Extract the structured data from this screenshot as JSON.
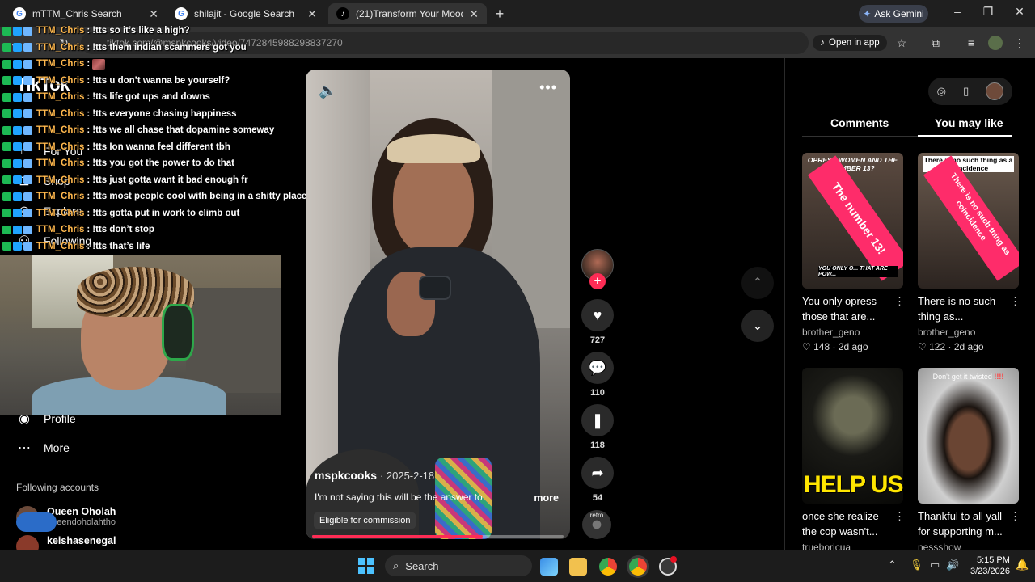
{
  "browser": {
    "tabs": [
      {
        "title": "mTTM_Chris Search",
        "favicon": "G"
      },
      {
        "title": "shilajit - Google Search",
        "favicon": "G"
      },
      {
        "title": "(21)Transform Your Mood with",
        "favicon": "♪"
      }
    ],
    "new_tab": "+",
    "gemini_label": "Ask Gemini",
    "url": "tiktok.com/@mspkcooks/video/7472845988298837270",
    "open_in_app": "Open in app",
    "window_controls": [
      "–",
      "❐",
      "✕"
    ]
  },
  "sidebar": {
    "logo": "TikTok",
    "nav": [
      {
        "label": "For You",
        "icon": "home-icon"
      },
      {
        "label": "Shop",
        "icon": "bag-icon"
      },
      {
        "label": "Explore",
        "icon": "compass-icon"
      },
      {
        "label": "Following",
        "icon": "users-icon"
      },
      {
        "label": "Profile",
        "icon": "profile-icon"
      },
      {
        "label": "More",
        "icon": "dots-icon"
      }
    ],
    "following_title": "Following accounts",
    "accounts": [
      {
        "name": "Queen Oholah",
        "handle": "queendoholahtho"
      },
      {
        "name": "keishasenegal",
        "handle": ""
      }
    ]
  },
  "chat": [
    {
      "user": "TTM_Chris",
      "msg": "!tts so it’s like a high?"
    },
    {
      "user": "TTM_Chris",
      "msg": "!tts them indian scammers got you"
    },
    {
      "user": "TTM_Chris",
      "msg": ""
    },
    {
      "user": "TTM_Chris",
      "msg": "!tts u don’t wanna be yourself?"
    },
    {
      "user": "TTM_Chris",
      "msg": "!tts life got ups and downs"
    },
    {
      "user": "TTM_Chris",
      "msg": "!tts everyone chasing happiness"
    },
    {
      "user": "TTM_Chris",
      "msg": "!tts we all chase that dopamine someway"
    },
    {
      "user": "TTM_Chris",
      "msg": "!tts Ion wanna feel different tbh"
    },
    {
      "user": "TTM_Chris",
      "msg": "!tts you got the power to do that"
    },
    {
      "user": "TTM_Chris",
      "msg": "!tts just gotta want it bad enough fr"
    },
    {
      "user": "TTM_Chris",
      "msg": "!tts most people cool with being in a shitty place"
    },
    {
      "user": "TTM_Chris",
      "msg": "!tts gotta put in work to climb out"
    },
    {
      "user": "TTM_Chris",
      "msg": "!tts don’t stop"
    },
    {
      "user": "TTM_Chris",
      "msg": "!tts that’s life"
    }
  ],
  "video": {
    "author": "mspkcooks",
    "date": "· 2025-2-18",
    "caption": "I'm not saying this will be the answer to",
    "more": "more",
    "badge": "Eligible for commission",
    "progress": 0.68
  },
  "actions": {
    "likes": "727",
    "comments": "110",
    "saves": "118",
    "shares": "54",
    "disc_label": "retro"
  },
  "right_panel": {
    "tabs": [
      "Comments",
      "You may like"
    ],
    "active_tab": "You may like",
    "cards": [
      {
        "title": "You only opress those that are...",
        "author": "brother_geno",
        "likes": "148",
        "age": "2d ago",
        "thumb_caption": "OPRESS WOMEN AND THE NUMBER 13?",
        "ribbon": "The number 13!",
        "thumb_caption2": "YOU ONLY O... THAT ARE POW..."
      },
      {
        "title": "There is no such thing as...",
        "author": "brother_geno",
        "likes": "122",
        "age": "2d ago",
        "thumb_caption": "There is no such thing as a coincidence",
        "ribbon": "There is no such thing as coincidence"
      },
      {
        "title": "once she realize the cop wasn't...",
        "author": "trueboricua",
        "thumb_caption": "HELP US"
      },
      {
        "title": "Thankful to all yall for supporting m...",
        "author": "nessshow",
        "thumb_caption": "Don't get it twisted",
        "thumb_marks": "!!!!"
      }
    ]
  },
  "taskbar": {
    "search": "Search",
    "time": "5:15 PM",
    "date": "3/23/2026"
  }
}
